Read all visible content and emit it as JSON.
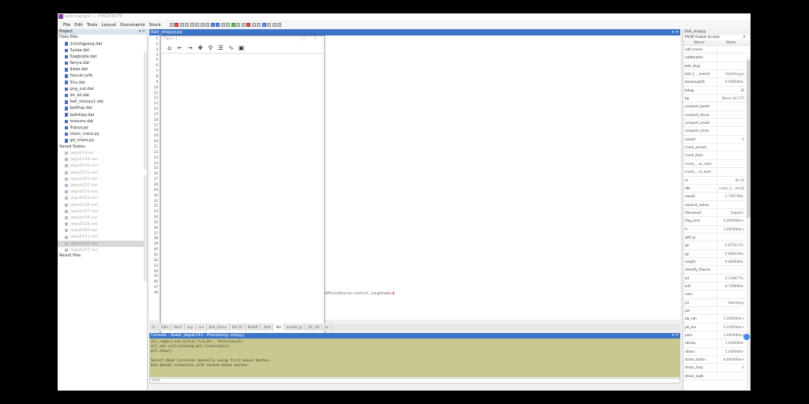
{
  "window": {
    "title": "pahcnwprg/ai — PPAGE/BUTE"
  },
  "menu": [
    {
      "label": "File"
    },
    {
      "label": "Edit"
    },
    {
      "label": "Tools"
    },
    {
      "label": "Layout"
    },
    {
      "label": "Documents"
    },
    {
      "label": "Stock"
    }
  ],
  "project": {
    "title": "Project",
    "data_files_heading": "Data files",
    "data_files": [
      {
        "label": "1chohgpang.dat"
      },
      {
        "label": "5ysaa.dat"
      },
      {
        "label": "5jagbojlie.dat"
      },
      {
        "label": "fwnya.dat"
      },
      {
        "label": "Ijsiax.dat"
      },
      {
        "label": "haccan.pilb"
      },
      {
        "label": "5hu.dat"
      },
      {
        "label": "png_out.dat"
      },
      {
        "label": "dn_all.dat"
      },
      {
        "label": "ball_shuoyy1.dat"
      },
      {
        "label": "ballfiup.dat"
      },
      {
        "label": "ballshpp.dat"
      },
      {
        "label": "masuno.dat"
      },
      {
        "label": "lhqsyy.py"
      },
      {
        "label": "ctoes_crace.py"
      },
      {
        "label": "gd_citaro.py"
      }
    ],
    "saved_states_heading": "Saved States",
    "saved_states": [
      {
        "label": "jwgub14sav"
      },
      {
        "label": "jwgub148.sav"
      },
      {
        "label": "jwgub150.sav"
      },
      {
        "label": "jwgub151.sav"
      },
      {
        "label": "jwgub152.sav"
      },
      {
        "label": "jwgub153.sav"
      },
      {
        "label": "jwgub154.sav"
      },
      {
        "label": "jwgub155.sav"
      },
      {
        "label": "jwgub156.sav"
      },
      {
        "label": "jwgub157.sav"
      },
      {
        "label": "jwgub158.sav"
      },
      {
        "label": "jwgub159.sav"
      },
      {
        "label": "jwgub160.sav"
      },
      {
        "label": "jwgub161.sav"
      },
      {
        "label": "jwgub162.sav"
      },
      {
        "label": "jwgub163.sav"
      }
    ],
    "result_files_heading": "Result files"
  },
  "editor": {
    "tab_title": "Ball_shspyy.py",
    "line_numbers": [
      "1",
      "2",
      "3",
      "4",
      "5",
      "6",
      "7",
      "8",
      "9",
      "10",
      "11",
      "12",
      "13",
      "14",
      "15",
      "16",
      "17",
      "18",
      "19",
      "20",
      "21",
      "22",
      "23",
      "24",
      "25",
      "26",
      "27",
      "28",
      "29",
      "30",
      "31",
      "32",
      "33",
      "34",
      "35",
      "36",
      "37",
      "38",
      "39",
      "40",
      "41",
      "42",
      "43",
      "44",
      "45",
      "46",
      "47",
      "48"
    ],
    "code_fragment": "thPoiseStarse:control_longStude=",
    "code_number": "0",
    "bottom_tabs": [
      {
        "label": "51"
      },
      {
        "label": "Elter"
      },
      {
        "label": "lbcol"
      },
      {
        "label": "sup"
      },
      {
        "label": "cvs"
      },
      {
        "label": "Ball_1trnns"
      },
      {
        "label": "Bal.10"
      },
      {
        "label": "BallUfl"
      },
      {
        "label": "adot"
      },
      {
        "label": "Bal"
      },
      {
        "label": "anrode_pr"
      },
      {
        "label": "gfc_dill"
      },
      {
        "label": "pc"
      }
    ]
  },
  "plot": {
    "title": "Figure 1"
  },
  "console": {
    "title": "Console - State: jwgub143 - Processing: shspyy",
    "lines": [
      "all_rawprs.set_title('t=1=1%', fontsize=11)",
      "all_val.call(unsinnp-plt_lines(1a1c))",
      "plt.show()",
      "",
      "Select Dead locations manually using first mouse button.",
      "End manual selection with second mouse button."
    ],
    "prompt": ">>>"
  },
  "properties": {
    "title": "Ball_shspyy",
    "subtitle": "PIGM Global Scripts",
    "col_name": "Name",
    "col_value": "Value",
    "rows": [
      {
        "name": "add_tracel",
        "value": ""
      },
      {
        "name": "addtorotile",
        "value": ""
      },
      {
        "name": "ball_shsp",
        "value": ""
      },
      {
        "name": "ball_t…_name1",
        "value": "'ballshsyy.p"
      },
      {
        "name": "baneouphth",
        "value": "8.000000e-"
      },
      {
        "name": "bdiop",
        "value": "ID"
      },
      {
        "name": "bp",
        "value": "None list 177"
      },
      {
        "name": "compsrt_lpotm",
        "value": ""
      },
      {
        "name": "compsrt_stcua",
        "value": ""
      },
      {
        "name": "compsrt_soods",
        "value": ""
      },
      {
        "name": "compsrt_ctrws",
        "value": ""
      },
      {
        "name": "countl",
        "value": "1"
      },
      {
        "name": "crack_accum",
        "value": ""
      },
      {
        "name": "crack_foon",
        "value": ""
      },
      {
        "name": "crack_…ur_num",
        "value": ""
      },
      {
        "name": "crack_…rs_num",
        "value": ""
      },
      {
        "name": "ct",
        "value": "ID 54"
      },
      {
        "name": "dbr",
        "value": "crack_1…ord,D"
      },
      {
        "name": "eaxd2",
        "value": "2.792799e-"
      },
      {
        "name": "expand_radius",
        "value": ""
      },
      {
        "name": "filename1",
        "value": "'jwgub1-"
      },
      {
        "name": "flag_time",
        "value": "0.000000e+"
      },
      {
        "name": "fr",
        "value": "1.000000e+"
      },
      {
        "name": "getl_g",
        "value": ""
      },
      {
        "name": "gx",
        "value": "6.872217e-"
      },
      {
        "name": "gy",
        "value": "6.666220e-"
      },
      {
        "name": "height",
        "value": "8.000000e-"
      },
      {
        "name": "identify_floxces",
        "value": ""
      },
      {
        "name": "kd",
        "value": "4.129477e-"
      },
      {
        "name": "kd1",
        "value": "8.749969e-"
      },
      {
        "name": "nam",
        "value": ""
      },
      {
        "name": "p1",
        "value": "'ballshpyy"
      },
      {
        "name": "pw",
        "value": ""
      },
      {
        "name": "pb_coh",
        "value": "3.200000e+"
      },
      {
        "name": "pb_ten",
        "value": "5.250000e+"
      },
      {
        "name": "poro",
        "value": "1.000000e+"
      },
      {
        "name": "rdmax",
        "value": "1.000000e-"
      },
      {
        "name": "rdmin",
        "value": "2.000000e-"
      },
      {
        "name": "strain_factor",
        "value": "8.000000e+"
      },
      {
        "name": "strain_freq",
        "value": "1"
      },
      {
        "name": "strain_walk",
        "value": ""
      }
    ]
  }
}
